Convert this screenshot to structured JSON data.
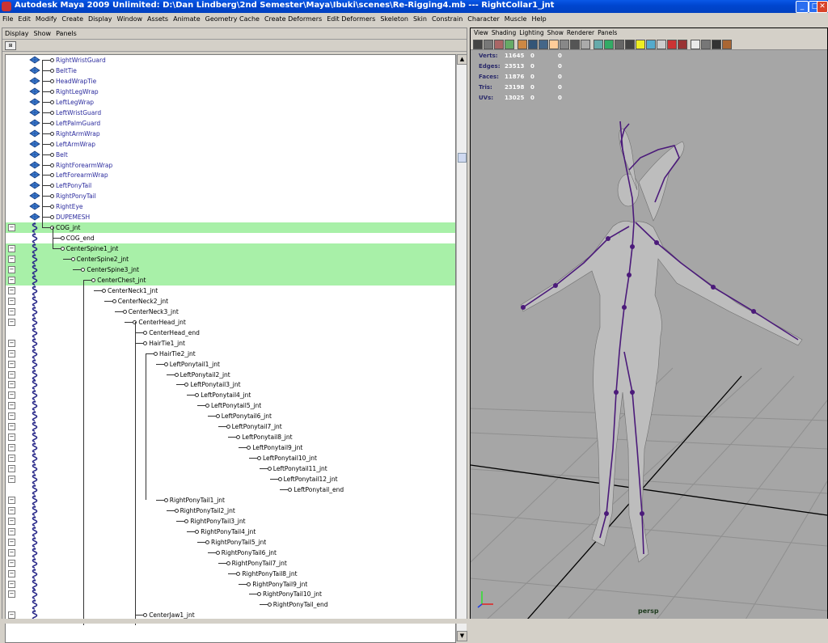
{
  "window": {
    "title": "Autodesk Maya 2009 Unlimited: D:\\Dan Lindberg\\2nd Semester\\Maya\\Ibuki\\scenes\\Re-Rigging4.mb  ---  RightCollar1_jnt",
    "minimize_label": "_",
    "maximize_label": "□",
    "close_label": "✕"
  },
  "menubar": [
    "File",
    "Edit",
    "Modify",
    "Create",
    "Display",
    "Window",
    "Assets",
    "Animate",
    "Geometry Cache",
    "Create Deformers",
    "Edit Deformers",
    "Skeleton",
    "Skin",
    "Constrain",
    "Character",
    "Muscle",
    "Help"
  ],
  "outliner": {
    "menus": [
      "Display",
      "Show",
      "Panels"
    ],
    "rows": [
      {
        "label": "RightWristGuard",
        "kind": "mesh",
        "depth": 0
      },
      {
        "label": "BeltTie",
        "kind": "mesh",
        "depth": 0
      },
      {
        "label": "HeadWrapTie",
        "kind": "mesh",
        "depth": 0
      },
      {
        "label": "RightLegWrap",
        "kind": "mesh",
        "depth": 0
      },
      {
        "label": "LeftLegWrap",
        "kind": "mesh",
        "depth": 0
      },
      {
        "label": "LeftWristGuard",
        "kind": "mesh",
        "depth": 0
      },
      {
        "label": "LeftPalmGuard",
        "kind": "mesh",
        "depth": 0
      },
      {
        "label": "RightArmWrap",
        "kind": "mesh",
        "depth": 0
      },
      {
        "label": "LeftArmWrap",
        "kind": "mesh",
        "depth": 0
      },
      {
        "label": "Belt",
        "kind": "mesh",
        "depth": 0
      },
      {
        "label": "RightForearmWrap",
        "kind": "mesh",
        "depth": 0
      },
      {
        "label": "LeftForearmWrap",
        "kind": "mesh",
        "depth": 0
      },
      {
        "label": "LeftPonyTail",
        "kind": "mesh",
        "depth": 0
      },
      {
        "label": "RightPonyTail",
        "kind": "mesh",
        "depth": 0
      },
      {
        "label": "RightEye",
        "kind": "mesh",
        "depth": 0
      },
      {
        "label": "DUPEMESH",
        "kind": "mesh",
        "depth": 0
      },
      {
        "label": "COG_jnt",
        "kind": "joint",
        "depth": 0,
        "expand": "⊟",
        "sel": true
      },
      {
        "label": "COG_end",
        "kind": "joint",
        "depth": 1
      },
      {
        "label": "CenterSpine1_jnt",
        "kind": "joint",
        "depth": 1,
        "expand": "⊟",
        "sel": true
      },
      {
        "label": "CenterSpine2_jnt",
        "kind": "joint",
        "depth": 2,
        "expand": "⊟",
        "sel": true
      },
      {
        "label": "CenterSpine3_jnt",
        "kind": "joint",
        "depth": 3,
        "expand": "⊟",
        "sel": true
      },
      {
        "label": "CenterChest_jnt",
        "kind": "joint",
        "depth": 4,
        "expand": "⊟",
        "sel": true
      },
      {
        "label": "CenterNeck1_jnt",
        "kind": "joint",
        "depth": 5,
        "expand": "⊟"
      },
      {
        "label": "CenterNeck2_jnt",
        "kind": "joint",
        "depth": 6,
        "expand": "⊟"
      },
      {
        "label": "CenterNeck3_jnt",
        "kind": "joint",
        "depth": 7,
        "expand": "⊟"
      },
      {
        "label": "CenterHead_jnt",
        "kind": "joint",
        "depth": 8,
        "expand": "⊟"
      },
      {
        "label": "CenterHead_end",
        "kind": "joint",
        "depth": 9
      },
      {
        "label": "HairTie1_jnt",
        "kind": "joint",
        "depth": 9,
        "expand": "⊟"
      },
      {
        "label": "HairTie2_jnt",
        "kind": "joint",
        "depth": 10,
        "expand": "⊟"
      },
      {
        "label": "LeftPonytail1_jnt",
        "kind": "joint",
        "depth": 11,
        "expand": "⊟"
      },
      {
        "label": "LeftPonytail2_jnt",
        "kind": "joint",
        "depth": 12,
        "expand": "⊟"
      },
      {
        "label": "LeftPonytail3_jnt",
        "kind": "joint",
        "depth": 13,
        "expand": "⊟"
      },
      {
        "label": "LeftPonytail4_jnt",
        "kind": "joint",
        "depth": 14,
        "expand": "⊟"
      },
      {
        "label": "LeftPonytail5_jnt",
        "kind": "joint",
        "depth": 15,
        "expand": "⊟"
      },
      {
        "label": "LeftPonytail6_jnt",
        "kind": "joint",
        "depth": 16,
        "expand": "⊟"
      },
      {
        "label": "LeftPonytail7_jnt",
        "kind": "joint",
        "depth": 17,
        "expand": "⊟"
      },
      {
        "label": "LeftPonytail8_jnt",
        "kind": "joint",
        "depth": 18,
        "expand": "⊟"
      },
      {
        "label": "LeftPonytail9_jnt",
        "kind": "joint",
        "depth": 19,
        "expand": "⊟"
      },
      {
        "label": "LeftPonytail10_jnt",
        "kind": "joint",
        "depth": 20,
        "expand": "⊟"
      },
      {
        "label": "LeftPonytail11_jnt",
        "kind": "joint",
        "depth": 21,
        "expand": "⊟"
      },
      {
        "label": "LeftPonytail12_jnt",
        "kind": "joint",
        "depth": 22,
        "expand": "⊟"
      },
      {
        "label": "LeftPonytail_end",
        "kind": "joint",
        "depth": 23
      },
      {
        "label": "RightPonyTail1_jnt",
        "kind": "joint",
        "depth": 11,
        "expand": "⊟"
      },
      {
        "label": "RightPonyTail2_jnt",
        "kind": "joint",
        "depth": 12,
        "expand": "⊟"
      },
      {
        "label": "RightPonyTail3_jnt",
        "kind": "joint",
        "depth": 13,
        "expand": "⊟"
      },
      {
        "label": "RightPonyTail4_jnt",
        "kind": "joint",
        "depth": 14,
        "expand": "⊟"
      },
      {
        "label": "RightPonyTail5_jnt",
        "kind": "joint",
        "depth": 15,
        "expand": "⊟"
      },
      {
        "label": "RightPonyTail6_jnt",
        "kind": "joint",
        "depth": 16,
        "expand": "⊟"
      },
      {
        "label": "RightPonyTail7_jnt",
        "kind": "joint",
        "depth": 17,
        "expand": "⊟"
      },
      {
        "label": "RightPonyTail8_jnt",
        "kind": "joint",
        "depth": 18,
        "expand": "⊟"
      },
      {
        "label": "RightPonyTail9_jnt",
        "kind": "joint",
        "depth": 19,
        "expand": "⊟"
      },
      {
        "label": "RightPonyTail10_jnt",
        "kind": "joint",
        "depth": 20,
        "expand": "⊟"
      },
      {
        "label": "RightPonyTail_end",
        "kind": "joint",
        "depth": 21
      },
      {
        "label": "CenterJaw1_jnt",
        "kind": "joint",
        "depth": 9,
        "expand": "⊟"
      }
    ],
    "colors": {
      "mesh_text": "#2b2b9e",
      "selection": "#a8f0a8",
      "joint_icon": "#2a2a8a"
    }
  },
  "viewport": {
    "menus": [
      "View",
      "Shading",
      "Lighting",
      "Show",
      "Renderer",
      "Panels"
    ],
    "hud": [
      {
        "label": "Verts:",
        "v1": "11645",
        "v2": "0",
        "v3": "0"
      },
      {
        "label": "Edges:",
        "v1": "23513",
        "v2": "0",
        "v3": "0"
      },
      {
        "label": "Faces:",
        "v1": "11876",
        "v2": "0",
        "v3": "0"
      },
      {
        "label": "Tris:",
        "v1": "23198",
        "v2": "0",
        "v3": "0"
      },
      {
        "label": "UVs:",
        "v1": "13025",
        "v2": "0",
        "v3": "0"
      }
    ],
    "camera_label": "persp",
    "colors": {
      "background": "#a6a6a6",
      "grid": "#8c8c8c",
      "skeleton": "#4b1a7a",
      "model": "#bdbdbd"
    }
  }
}
